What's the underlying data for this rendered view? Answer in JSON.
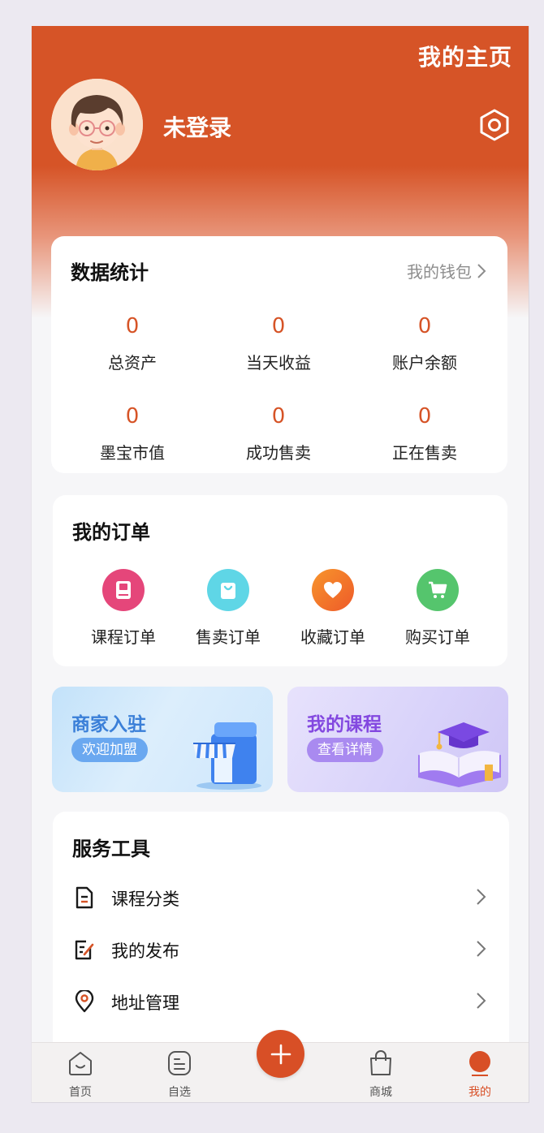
{
  "header": {
    "title": "我的主页",
    "username": "未登录"
  },
  "stats": {
    "title": "数据统计",
    "wallet_link": "我的钱包",
    "items": [
      {
        "value": "0",
        "label": "总资产"
      },
      {
        "value": "0",
        "label": "当天收益"
      },
      {
        "value": "0",
        "label": "账户余额"
      },
      {
        "value": "0",
        "label": "墨宝市值"
      },
      {
        "value": "0",
        "label": "成功售卖"
      },
      {
        "value": "0",
        "label": "正在售卖"
      }
    ]
  },
  "orders": {
    "title": "我的订单",
    "items": [
      {
        "label": "课程订单",
        "icon": "book-icon",
        "color": "#e5467a"
      },
      {
        "label": "售卖订单",
        "icon": "shopping-bag-icon",
        "color": "#5fd6e6"
      },
      {
        "label": "收藏订单",
        "icon": "heart-icon",
        "color": "#f2712a"
      },
      {
        "label": "购买订单",
        "icon": "cart-icon",
        "color": "#55c56d"
      }
    ]
  },
  "promos": {
    "merchant": {
      "title": "商家入驻",
      "button": "欢迎加盟"
    },
    "courses": {
      "title": "我的课程",
      "button": "查看详情"
    }
  },
  "tools": {
    "title": "服务工具",
    "items": [
      {
        "label": "课程分类",
        "icon": "document-icon"
      },
      {
        "label": "我的发布",
        "icon": "edit-icon"
      },
      {
        "label": "地址管理",
        "icon": "location-pin-icon"
      }
    ]
  },
  "tabbar": {
    "items": [
      {
        "label": "首页",
        "icon": "home-icon"
      },
      {
        "label": "自选",
        "icon": "list-icon"
      },
      {
        "label": "商城",
        "icon": "bag-icon"
      },
      {
        "label": "我的",
        "icon": "profile-icon",
        "active": true
      }
    ],
    "active_color": "#d84f26"
  },
  "colors": {
    "brand": "#d65427",
    "stat_value": "#d65427"
  }
}
